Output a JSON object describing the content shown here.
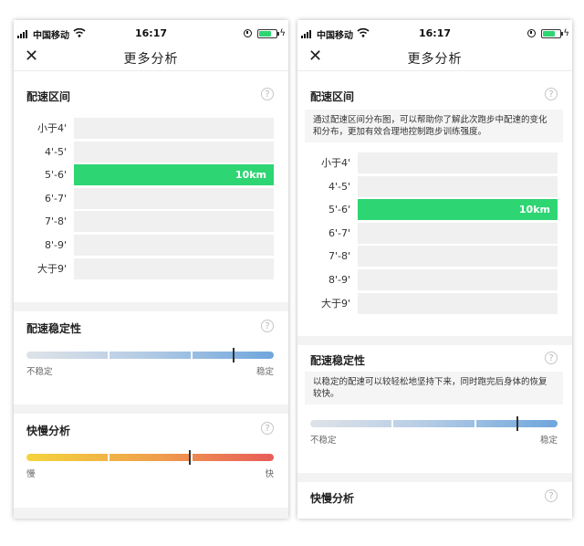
{
  "screens": [
    {
      "status": {
        "carrier": "中国移动",
        "time": "16:17"
      },
      "nav": {
        "close": "✕",
        "title": "更多分析"
      },
      "pace": {
        "title": "配速区间",
        "help": "?",
        "rows": [
          {
            "label": "小于4'",
            "value": "",
            "active": false
          },
          {
            "label": "4'-5'",
            "value": "",
            "active": false
          },
          {
            "label": "5'-6'",
            "value": "10km",
            "active": true
          },
          {
            "label": "6'-7'",
            "value": "",
            "active": false
          },
          {
            "label": "7'-8'",
            "value": "",
            "active": false
          },
          {
            "label": "8'-9'",
            "value": "",
            "active": false
          },
          {
            "label": "大于9'",
            "value": "",
            "active": false
          }
        ]
      },
      "stability": {
        "title": "配速稳定性",
        "help": "?",
        "min": "不稳定",
        "max": "稳定",
        "level": 0.835
      },
      "speed": {
        "title": "快慢分析",
        "help": "?",
        "min": "慢",
        "max": "快",
        "level": 0.655
      }
    },
    {
      "status": {
        "carrier": "中国移动",
        "time": "16:17"
      },
      "nav": {
        "close": "✕",
        "title": "更多分析"
      },
      "pace": {
        "title": "配速区间",
        "help": "?",
        "description": "通过配速区间分布图，可以帮助你了解此次跑步中配速的变化和分布，更加有效合理地控制跑步训练强度。",
        "rows": [
          {
            "label": "小于4'",
            "value": "",
            "active": false
          },
          {
            "label": "4'-5'",
            "value": "",
            "active": false
          },
          {
            "label": "5'-6'",
            "value": "10km",
            "active": true
          },
          {
            "label": "6'-7'",
            "value": "",
            "active": false
          },
          {
            "label": "7'-8'",
            "value": "",
            "active": false
          },
          {
            "label": "8'-9'",
            "value": "",
            "active": false
          },
          {
            "label": "大于9'",
            "value": "",
            "active": false
          }
        ]
      },
      "stability": {
        "title": "配速稳定性",
        "help": "?",
        "description": "以稳定的配速可以较轻松地坚持下来，同时跑完后身体的恢复较快。",
        "min": "不稳定",
        "max": "稳定",
        "level": 0.835
      },
      "speed": {
        "title": "快慢分析",
        "help": "?"
      }
    }
  ],
  "colors": {
    "active_bar": "#2ed573",
    "inactive_bar": "#f0f0f0",
    "battery": "#2ed573"
  },
  "icons": {
    "close": "close-icon",
    "help": "help-icon",
    "signal": "signal-icon",
    "wifi": "wifi-icon",
    "battery": "battery-icon"
  }
}
